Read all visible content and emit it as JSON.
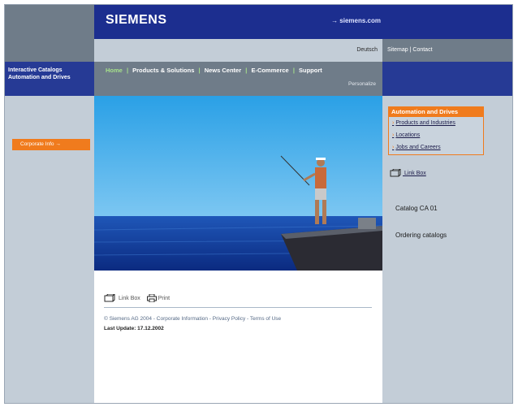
{
  "header": {
    "logo_text": "SIEMENS",
    "external_link": "→ siemens.com"
  },
  "lang_bar": {
    "language_link": "Deutsch"
  },
  "utility": {
    "links": "Sitemap | Contact"
  },
  "sidebar": {
    "title_line1": "Interactive Catalogs",
    "title_line2": "Automation and Drives",
    "corporate_button": "Corporate Info  →"
  },
  "nav": {
    "home": "Home",
    "items": [
      "Products & Solutions",
      "News Center",
      "E-Commerce",
      "Support"
    ],
    "sep": "|",
    "personalize": "Personalize"
  },
  "right_panel": {
    "box_title": "Automation and Drives",
    "links": [
      "Products and Industries",
      "Locations",
      "Jobs and Careers"
    ],
    "link_box": "Link Box",
    "catalog_ca01": "Catalog CA 01",
    "ordering": "Ordering catalogs"
  },
  "content": {
    "link_box": "Link Box",
    "print": "Print",
    "footer": "© Siemens AG 2004 - Corporate Information - Privacy Policy - Terms of Use",
    "last_update": "Last Update: 17.12.2002"
  },
  "colors": {
    "brand_blue": "#1c2e8f",
    "accent_orange": "#f07b1d",
    "nav_gray": "#6f7c89",
    "home_green": "#a6e18a"
  }
}
